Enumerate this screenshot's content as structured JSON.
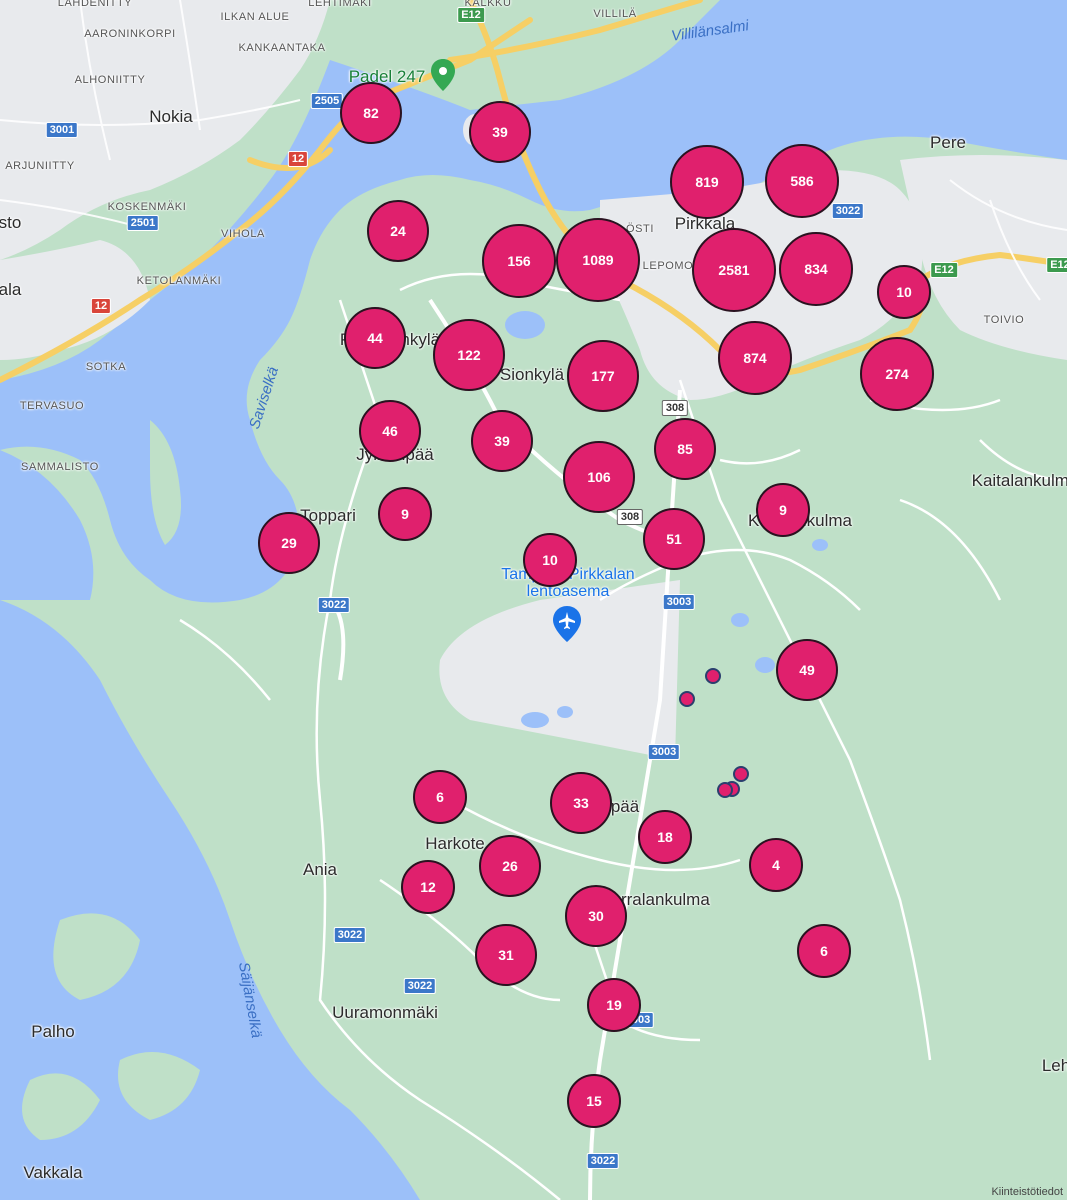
{
  "map": {
    "colors": {
      "land": "#bfe0c8",
      "water": "#9cc0f9",
      "urban": "#e8eaed",
      "road_major": "#f6cf65",
      "marker": "#e0206d",
      "marker_border": "#2a1220"
    },
    "clusters": [
      {
        "id": "c82",
        "count": "82",
        "size": "medium"
      },
      {
        "id": "c39a",
        "count": "39",
        "size": "medium"
      },
      {
        "id": "c819",
        "count": "819",
        "size": "large"
      },
      {
        "id": "c586",
        "count": "586",
        "size": "large"
      },
      {
        "id": "c24",
        "count": "24",
        "size": "medium"
      },
      {
        "id": "c156",
        "count": "156",
        "size": "large"
      },
      {
        "id": "c1089",
        "count": "1089",
        "size": "xlarge"
      },
      {
        "id": "c2581",
        "count": "2581",
        "size": "xlarge"
      },
      {
        "id": "c834",
        "count": "834",
        "size": "large"
      },
      {
        "id": "c10a",
        "count": "10",
        "size": "medium"
      },
      {
        "id": "c44",
        "count": "44",
        "size": "medium"
      },
      {
        "id": "c122",
        "count": "122",
        "size": "large"
      },
      {
        "id": "c177",
        "count": "177",
        "size": "large"
      },
      {
        "id": "c874",
        "count": "874",
        "size": "large"
      },
      {
        "id": "c274",
        "count": "274",
        "size": "large"
      },
      {
        "id": "c46",
        "count": "46",
        "size": "medium"
      },
      {
        "id": "c39b",
        "count": "39",
        "size": "medium"
      },
      {
        "id": "c85",
        "count": "85",
        "size": "medium"
      },
      {
        "id": "c106",
        "count": "106",
        "size": "large"
      },
      {
        "id": "c9a",
        "count": "9",
        "size": "medium"
      },
      {
        "id": "c9b",
        "count": "9",
        "size": "medium"
      },
      {
        "id": "c29",
        "count": "29",
        "size": "medium"
      },
      {
        "id": "c10b",
        "count": "10",
        "size": "medium"
      },
      {
        "id": "c51",
        "count": "51",
        "size": "medium"
      },
      {
        "id": "c49",
        "count": "49",
        "size": "medium"
      },
      {
        "id": "c6a",
        "count": "6",
        "size": "medium"
      },
      {
        "id": "c33",
        "count": "33",
        "size": "medium"
      },
      {
        "id": "c18",
        "count": "18",
        "size": "medium"
      },
      {
        "id": "c26",
        "count": "26",
        "size": "medium"
      },
      {
        "id": "c4",
        "count": "4",
        "size": "medium"
      },
      {
        "id": "c12",
        "count": "12",
        "size": "medium"
      },
      {
        "id": "c30",
        "count": "30",
        "size": "medium"
      },
      {
        "id": "c6b",
        "count": "6",
        "size": "medium"
      },
      {
        "id": "c31",
        "count": "31",
        "size": "medium"
      },
      {
        "id": "c19",
        "count": "19",
        "size": "medium"
      },
      {
        "id": "c15",
        "count": "15",
        "size": "medium"
      }
    ],
    "places": {
      "lahdenitty": "LAHDENITTY",
      "lehtimaki": "LEHTIMÄKI",
      "kalkku": "KALKKU",
      "villila": "VILLILÄ",
      "ilkan_alue": "ILKAN ALUE",
      "aaroninkorpi": "AARONINKORPI",
      "kankaantaka": "KANKAANTAKA",
      "alhoniitty": "ALHONIITTY",
      "nokia": "Nokia",
      "arjuniitty": "ARJUNIITTY",
      "koskenmaki": "KOSKENMÄKI",
      "sto": "sto",
      "viholas": "VIHOLA",
      "ketolanmaki": "KETOLANMÄKI",
      "ala": "ala",
      "sotka": "SOTKA",
      "tervasuo": "TERVASUO",
      "sammalisto": "SAMMALISTO",
      "villilansalmi": "Villilänsalmi",
      "pere": "Pere",
      "pirkkala": "Pirkkala",
      "osti": "ÖSTI",
      "lepomo": "LEPOMO",
      "toivio": "TOIVIO",
      "paikinkyla": "Pirkkalankylä",
      "sionkyla": "Sionkylä",
      "jylhanpaa": "Jylhänpää",
      "toppari": "Toppari",
      "kaitalankulma": "Kaitalankulma",
      "kennankulma": "Kennonkulma",
      "saviselka": "Saviselkä",
      "airport": "Tampere-Pirkkalan lentoasema",
      "harkote": "Harkote",
      "ania": "Ania",
      "sorralankulma": "Sorralankulma",
      "sorampaa": "Sorampää",
      "saijanselka": "Säijänselkä",
      "uuramonmaki": "Uuramonmäki",
      "palho": "Palho",
      "vakkala": "Vakkala",
      "leh": "Leh"
    },
    "poi": {
      "padel": "Padel 247"
    },
    "shields": {
      "r3001": "3001",
      "r2505": "2505",
      "r12a": "12",
      "r2501": "2501",
      "r12b": "12",
      "e12a": "E12",
      "e12b": "E12",
      "e12c": "E12",
      "r3022a": "3022",
      "r308a": "308",
      "r308b": "308",
      "r3003a": "3003",
      "r3003b": "3003",
      "r3022b": "3022",
      "r3022c": "3022",
      "r3022d": "3022",
      "r3022e": "3022",
      "r3003c": "3003"
    },
    "attribution": "Kiinteistötiedot"
  }
}
